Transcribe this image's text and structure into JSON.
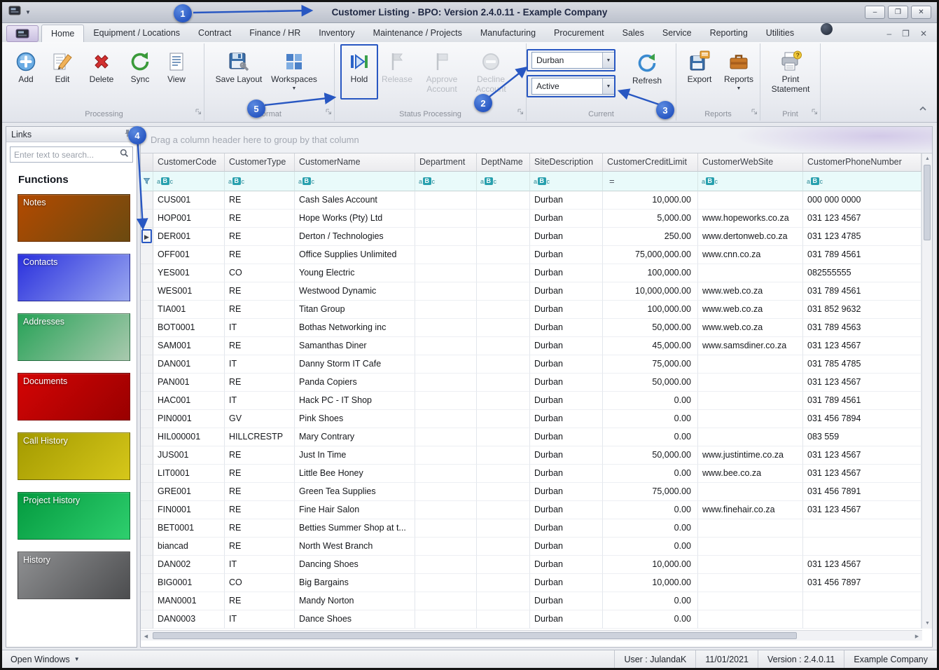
{
  "accent_color": "#2857c2",
  "titlebar": {
    "title": "Customer Listing - BPO: Version 2.4.0.11 - Example Company",
    "minimize": "–",
    "maximize": "❐",
    "close": "✕"
  },
  "ribbon": {
    "tabs": [
      "Home",
      "Equipment / Locations",
      "Contract",
      "Finance / HR",
      "Inventory",
      "Maintenance / Projects",
      "Manufacturing",
      "Procurement",
      "Sales",
      "Service",
      "Reporting",
      "Utilities"
    ],
    "active_tab_index": 0,
    "groups": {
      "processing": {
        "label": "Processing",
        "add": "Add",
        "edit": "Edit",
        "del": "Delete",
        "sync": "Sync",
        "view": "View"
      },
      "format": {
        "label": "Format",
        "save_layout": "Save Layout",
        "workspaces": "Workspaces"
      },
      "status_processing": {
        "label": "Status Processing",
        "hold": "Hold",
        "release": "Release",
        "approve": "Approve Account",
        "decline": "Decline Account"
      },
      "current": {
        "label": "Current",
        "site": "Durban",
        "status": "Active",
        "refresh": "Refresh"
      },
      "reports": {
        "label": "Reports",
        "export": "Export",
        "reports": "Reports"
      },
      "print": {
        "label": "Print",
        "print_statement": "Print Statement"
      }
    }
  },
  "links": {
    "header": "Links",
    "search_placeholder": "Enter text to search...",
    "functions_heading": "Functions",
    "items": [
      {
        "label": "Notes",
        "color_from": "#b34a00",
        "color_to": "#6b4a10"
      },
      {
        "label": "Contacts",
        "color_from": "#2a30dd",
        "color_to": "#9aa8f0"
      },
      {
        "label": "Addresses",
        "color_from": "#27a257",
        "color_to": "#a9c9ae"
      },
      {
        "label": "Documents",
        "color_from": "#d40505",
        "color_to": "#990000"
      },
      {
        "label": "Call History",
        "color_from": "#a39a00",
        "color_to": "#d6c71a"
      },
      {
        "label": "Project History",
        "color_from": "#049a3f",
        "color_to": "#2ecf6e"
      },
      {
        "label": "History",
        "color_from": "#8f9092",
        "color_to": "#4c4d4f"
      }
    ]
  },
  "grid": {
    "group_hint": "Drag a column header here to group by that column",
    "columns": [
      "CustomerCode",
      "CustomerType",
      "CustomerName",
      "Department",
      "DeptName",
      "SiteDescription",
      "CustomerCreditLimit",
      "CustomerWebSite",
      "CustomerPhoneNumber"
    ],
    "filter": {
      "credit_operator": "="
    },
    "selected_row_index": 2,
    "rows": [
      [
        "CUS001",
        "RE",
        "Cash Sales Account",
        "",
        "",
        "Durban",
        "10,000.00",
        "",
        "000 000 0000"
      ],
      [
        "HOP001",
        "RE",
        "Hope Works (Pty) Ltd",
        "",
        "",
        "Durban",
        "5,000.00",
        "www.hopeworks.co.za",
        "031 123 4567"
      ],
      [
        "DER001",
        "RE",
        "Derton / Technologies",
        "",
        "",
        "Durban",
        "250.00",
        "www.dertonweb.co.za",
        "031 123 4785"
      ],
      [
        "OFF001",
        "RE",
        "Office Supplies Unlimited",
        "",
        "",
        "Durban",
        "75,000,000.00",
        "www.cnn.co.za",
        "031 789 4561"
      ],
      [
        "YES001",
        "CO",
        "Young Electric",
        "",
        "",
        "Durban",
        "100,000.00",
        "",
        "082555555"
      ],
      [
        "WES001",
        "RE",
        "Westwood Dynamic",
        "",
        "",
        "Durban",
        "10,000,000.00",
        "www.web.co.za",
        "031 789 4561"
      ],
      [
        "TIA001",
        "RE",
        "Titan Group",
        "",
        "",
        "Durban",
        "100,000.00",
        "www.web.co.za",
        "031 852 9632"
      ],
      [
        "BOT0001",
        "IT",
        "Bothas Networking inc",
        "",
        "",
        "Durban",
        "50,000.00",
        "www.web.co.za",
        "031 789 4563"
      ],
      [
        "SAM001",
        "RE",
        "Samanthas Diner",
        "",
        "",
        "Durban",
        "45,000.00",
        "www.samsdiner.co.za",
        "031 123 4567"
      ],
      [
        "DAN001",
        "IT",
        "Danny Storm IT Cafe",
        "",
        "",
        "Durban",
        "75,000.00",
        "",
        "031 785 4785"
      ],
      [
        "PAN001",
        "RE",
        "Panda Copiers",
        "",
        "",
        "Durban",
        "50,000.00",
        "",
        "031 123 4567"
      ],
      [
        "HAC001",
        "IT",
        "Hack PC - IT Shop",
        "",
        "",
        "Durban",
        "0.00",
        "",
        "031 789 4561"
      ],
      [
        "PIN0001",
        "GV",
        "Pink Shoes",
        "",
        "",
        "Durban",
        "0.00",
        "",
        "031 456 7894"
      ],
      [
        "HIL000001",
        "HILLCRESTP",
        "Mary Contrary",
        "",
        "",
        "Durban",
        "0.00",
        "",
        "083 559"
      ],
      [
        "JUS001",
        "RE",
        "Just In Time",
        "",
        "",
        "Durban",
        "50,000.00",
        "www.justintime.co.za",
        "031 123 4567"
      ],
      [
        "LIT0001",
        "RE",
        "Little Bee Honey",
        "",
        "",
        "Durban",
        "0.00",
        "www.bee.co.za",
        "031 123 4567"
      ],
      [
        "GRE001",
        "RE",
        "Green Tea Supplies",
        "",
        "",
        "Durban",
        "75,000.00",
        "",
        "031 456 7891"
      ],
      [
        "FIN0001",
        "RE",
        "Fine Hair Salon",
        "",
        "",
        "Durban",
        "0.00",
        "www.finehair.co.za",
        "031 123 4567"
      ],
      [
        "BET0001",
        "RE",
        "Betties Summer Shop at t...",
        "",
        "",
        "Durban",
        "0.00",
        "",
        ""
      ],
      [
        "biancad",
        "RE",
        "North West Branch",
        "",
        "",
        "Durban",
        "0.00",
        "",
        ""
      ],
      [
        "DAN002",
        "IT",
        "Dancing Shoes",
        "",
        "",
        "Durban",
        "10,000.00",
        "",
        "031 123 4567"
      ],
      [
        "BIG0001",
        "CO",
        "Big Bargains",
        "",
        "",
        "Durban",
        "10,000.00",
        "",
        "031 456 7897"
      ],
      [
        "MAN0001",
        "RE",
        "Mandy Norton",
        "",
        "",
        "Durban",
        "0.00",
        "",
        ""
      ],
      [
        "DAN0003",
        "IT",
        "Dance Shoes",
        "",
        "",
        "Durban",
        "0.00",
        "",
        ""
      ]
    ]
  },
  "statusbar": {
    "open_windows": "Open Windows",
    "user": "User : JulandaK",
    "date": "11/01/2021",
    "version": "Version : 2.4.0.11",
    "company": "Example Company"
  },
  "annotations": {
    "badges": [
      "1",
      "2",
      "3",
      "4",
      "5"
    ]
  }
}
